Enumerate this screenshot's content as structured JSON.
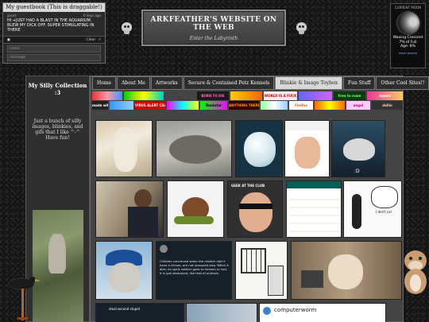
{
  "guestbook": {
    "title": "My guestbook (This is draggable!)",
    "entry_author": "guest",
    "entry_time": "6 days ago",
    "entry_text": "HI +JUST HAD A BLAST IN THE AQUARIUM. BLEW MY DICK OFF. SUPER STIMULATING IN THERE",
    "clear_label": "Clear",
    "name_placeholder": "name",
    "message_placeholder": "message"
  },
  "header": {
    "title": "ARKFEATHER'S WEBSITE ON THE WEB",
    "subtitle": "Enter the Labyrinth"
  },
  "moon": {
    "heading": "CURRENT MOON",
    "phase": "Waxing Crescent",
    "illumination": "7% of Full",
    "age": "Age: 8%",
    "link": "moon phases"
  },
  "sidebar": {
    "title": "My Silly Collection :3",
    "text": "Just a bunch of silly images, blinkies, and gifs that I like ^-^ Have fun!"
  },
  "nav": {
    "items": [
      {
        "label": "Home"
      },
      {
        "label": "About Me"
      },
      {
        "label": "Artworks"
      },
      {
        "label": "Secure & Contained Petz Kennels"
      },
      {
        "label": "Blinkie & Image Toybox"
      },
      {
        "label": "Fun Stuff"
      },
      {
        "label": "Other Cool Sites!!"
      }
    ]
  },
  "blinkies": {
    "row1": [
      "BORN TO DIE",
      "WORLD IS A FUCK",
      "Free to roam",
      "lovers"
    ],
    "row2": [
      "made with notepad",
      "VIRUS ALERT Click Here",
      "Rockstar",
      "ANYTHING THERE",
      "Firefox",
      "angel",
      "dollie"
    ]
  },
  "gallery": {
    "caption_d": ":D",
    "caption_geek": "GEEK AT THE CLUB",
    "caption_care": "I don't car",
    "caption_computerworm": "computerworm",
    "caption_steal": "steal second stupid",
    "tweet_text": "Children conceived when the mother didn't have a climax, are not unsouled also. When it dies, its spirit neither goes to heaven or hell, it is just destroyed, like that of animals."
  },
  "colors": {
    "page_bg": "#161616",
    "panel_bg": "#444444",
    "active_tab": "#d8d8d8"
  }
}
